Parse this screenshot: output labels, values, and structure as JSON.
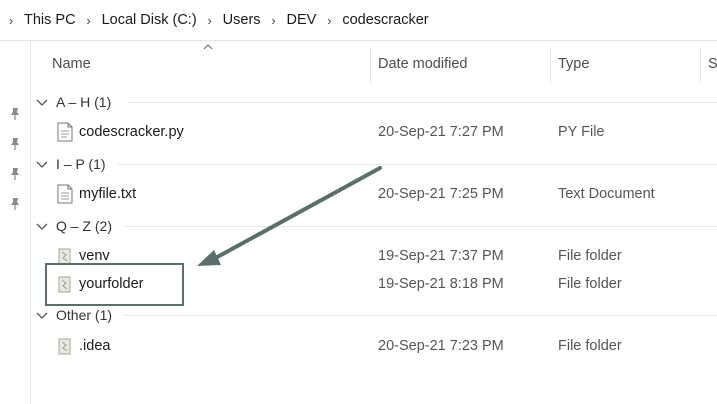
{
  "breadcrumb": {
    "items": [
      "This PC",
      "Local Disk (C:)",
      "Users",
      "DEV",
      "codescracker"
    ]
  },
  "columns": {
    "name": "Name",
    "date_modified": "Date modified",
    "type": "Type",
    "size": "S"
  },
  "groups": [
    {
      "label": "A – H (1)",
      "files": [
        {
          "name": "codescracker.py",
          "date": "20-Sep-21 7:27 PM",
          "type": "PY File",
          "icon": "python-file-icon"
        }
      ]
    },
    {
      "label": "I – P (1)",
      "files": [
        {
          "name": "myfile.txt",
          "date": "20-Sep-21 7:25 PM",
          "type": "Text Document",
          "icon": "text-file-icon"
        }
      ]
    },
    {
      "label": "Q – Z (2)",
      "files": [
        {
          "name": "venv",
          "date": "19-Sep-21 7:37 PM",
          "type": "File folder",
          "icon": "folder-icon"
        },
        {
          "name": "yourfolder",
          "date": "19-Sep-21 8:18 PM",
          "type": "File folder",
          "icon": "folder-icon"
        }
      ]
    },
    {
      "label": "Other (1)",
      "files": [
        {
          "name": ".idea",
          "date": "20-Sep-21 7:23 PM",
          "type": "File folder",
          "icon": "folder-icon"
        }
      ]
    }
  ],
  "colors": {
    "annotation": "#5a6e6a"
  }
}
